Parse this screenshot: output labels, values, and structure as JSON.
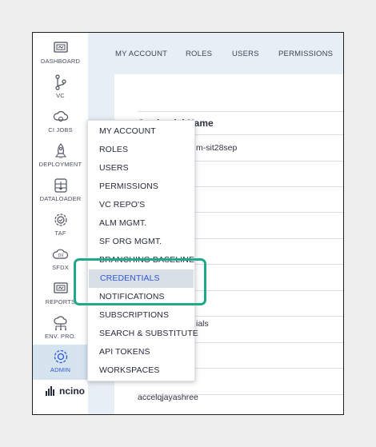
{
  "sidebar": {
    "items": [
      {
        "label": "DASHBOARD",
        "icon": "dashboard-icon"
      },
      {
        "label": "VC",
        "icon": "version-control-icon"
      },
      {
        "label": "CI JOBS",
        "icon": "cloud-gear-icon"
      },
      {
        "label": "DEPLOYMENT",
        "icon": "rocket-icon"
      },
      {
        "label": "DATALOADER",
        "icon": "database-icon"
      },
      {
        "label": "TAF",
        "icon": "gear-icon"
      },
      {
        "label": "SFDX",
        "icon": "sfdx-cloud-icon"
      },
      {
        "label": "REPORTS",
        "icon": "reports-icon"
      },
      {
        "label": "ENV. PRO.",
        "icon": "environment-cloud-icon"
      },
      {
        "label": "ADMIN",
        "icon": "admin-gear-icon",
        "active": true
      }
    ],
    "logo_text": "ncino"
  },
  "topnav": {
    "tabs": [
      "MY ACCOUNT",
      "ROLES",
      "USERS",
      "PERMISSIONS"
    ]
  },
  "table": {
    "header": "Credential Name",
    "visible_cells": [
      "m-sit28sep",
      "ials",
      "accelqjayashree"
    ]
  },
  "dropdown": {
    "items": [
      "MY ACCOUNT",
      "ROLES",
      "USERS",
      "PERMISSIONS",
      "VC REPO'S",
      "ALM MGMT.",
      "SF ORG MGMT.",
      "BRANCHING BASELINE",
      "CREDENTIALS",
      "NOTIFICATIONS",
      "SUBSCRIPTIONS",
      "SEARCH & SUBSTITUTE",
      "API TOKENS",
      "WORKSPACES"
    ],
    "selected": "CREDENTIALS"
  },
  "colors": {
    "accent": "#2c57d6",
    "active_bg": "#d6e4f0",
    "highlight_border": "#1fa98a",
    "content_bg": "#e8eef5"
  }
}
